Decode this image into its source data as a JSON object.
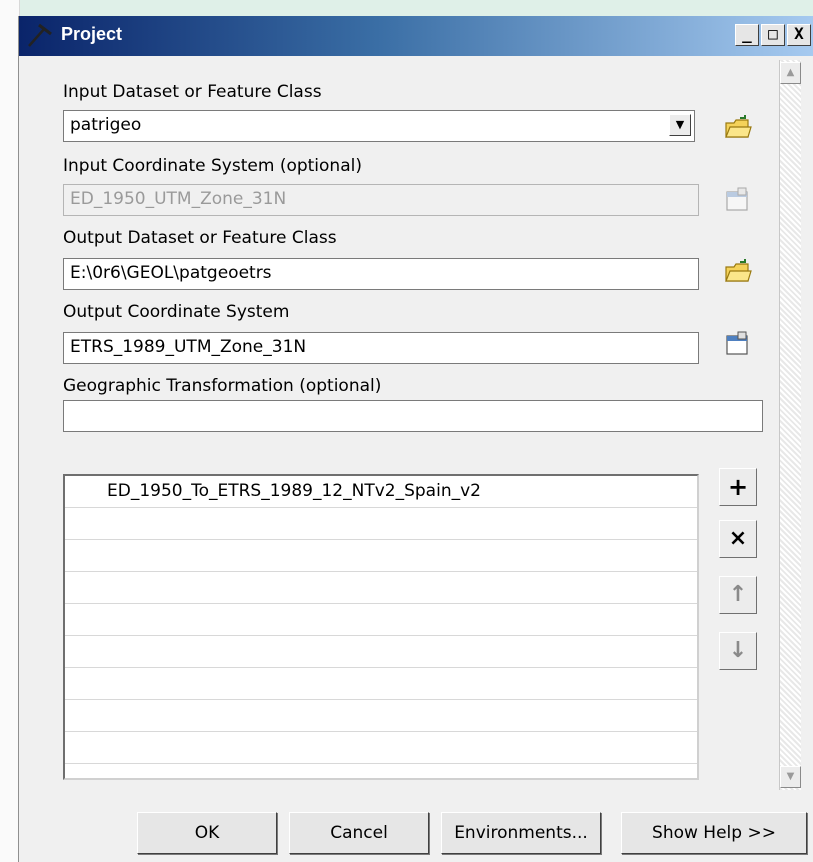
{
  "window": {
    "title": "Project",
    "controls": {
      "minimize": "_",
      "maximize": "□",
      "close": "X"
    }
  },
  "fields": {
    "input_dataset": {
      "label": "Input Dataset or Feature Class",
      "value": "patrigeo"
    },
    "input_cs": {
      "label": "Input Coordinate System (optional)",
      "value": "ED_1950_UTM_Zone_31N"
    },
    "output_dataset": {
      "label": "Output Dataset or Feature Class",
      "value": "E:\\0r6\\GEOL\\patgeoetrs"
    },
    "output_cs": {
      "label": "Output Coordinate System",
      "value": "ETRS_1989_UTM_Zone_31N"
    },
    "geo_transform": {
      "label": "Geographic Transformation (optional)",
      "value": ""
    }
  },
  "transform_list": {
    "items": [
      "ED_1950_To_ETRS_1989_12_NTv2_Spain_v2"
    ]
  },
  "side_buttons": {
    "add": "+",
    "remove": "×",
    "up": "↑",
    "down": "↓"
  },
  "buttons": {
    "ok": "OK",
    "cancel": "Cancel",
    "environments": "Environments...",
    "show_help": "Show Help >>"
  },
  "icons": {
    "title": "hammer-icon",
    "browse": "open-folder-icon",
    "spatial_reference": "spatial-reference-properties-icon"
  },
  "colors": {
    "titlebar_start": "#0a246a",
    "titlebar_end": "#a6caf0",
    "dialog_bg": "#f0f0f0"
  }
}
